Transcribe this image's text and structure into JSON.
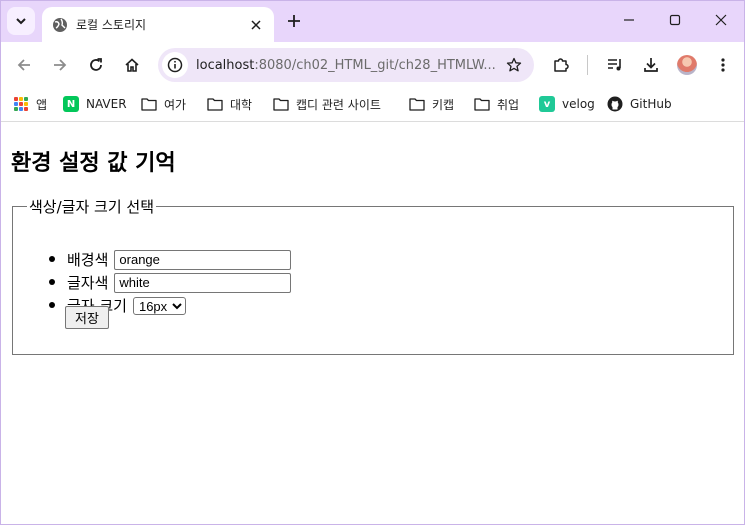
{
  "tab": {
    "title": "로컬 스토리지"
  },
  "address": {
    "host": "localhost",
    "path": ":8080/ch02_HTML_git/ch28_HTMLW..."
  },
  "bookmarks": [
    {
      "label": "앱",
      "icon": "apps-grid-icon"
    },
    {
      "label": "NAVER",
      "icon": "naver-icon"
    },
    {
      "label": "여가",
      "icon": "folder-icon"
    },
    {
      "label": "대학",
      "icon": "folder-icon"
    },
    {
      "label": "캡디 관련 사이트",
      "icon": "folder-icon"
    },
    {
      "label": "키캡",
      "icon": "folder-icon"
    },
    {
      "label": "취업",
      "icon": "folder-icon"
    },
    {
      "label": "velog",
      "icon": "velog-icon"
    },
    {
      "label": "GitHub",
      "icon": "github-icon"
    }
  ],
  "page": {
    "heading": "환경 설정 값 기억",
    "legend": "색상/글자 크기 선택",
    "bg_label": "배경색",
    "bg_value": "orange",
    "fg_label": "글자색",
    "fg_value": "white",
    "size_label": "글자 크기",
    "size_value": "16px",
    "save_label": "저장"
  },
  "colors": {
    "tabstrip": "#e8d6fb",
    "omnibox": "#efe6f8",
    "naver": "#03c75a",
    "velog": "#20c997"
  }
}
